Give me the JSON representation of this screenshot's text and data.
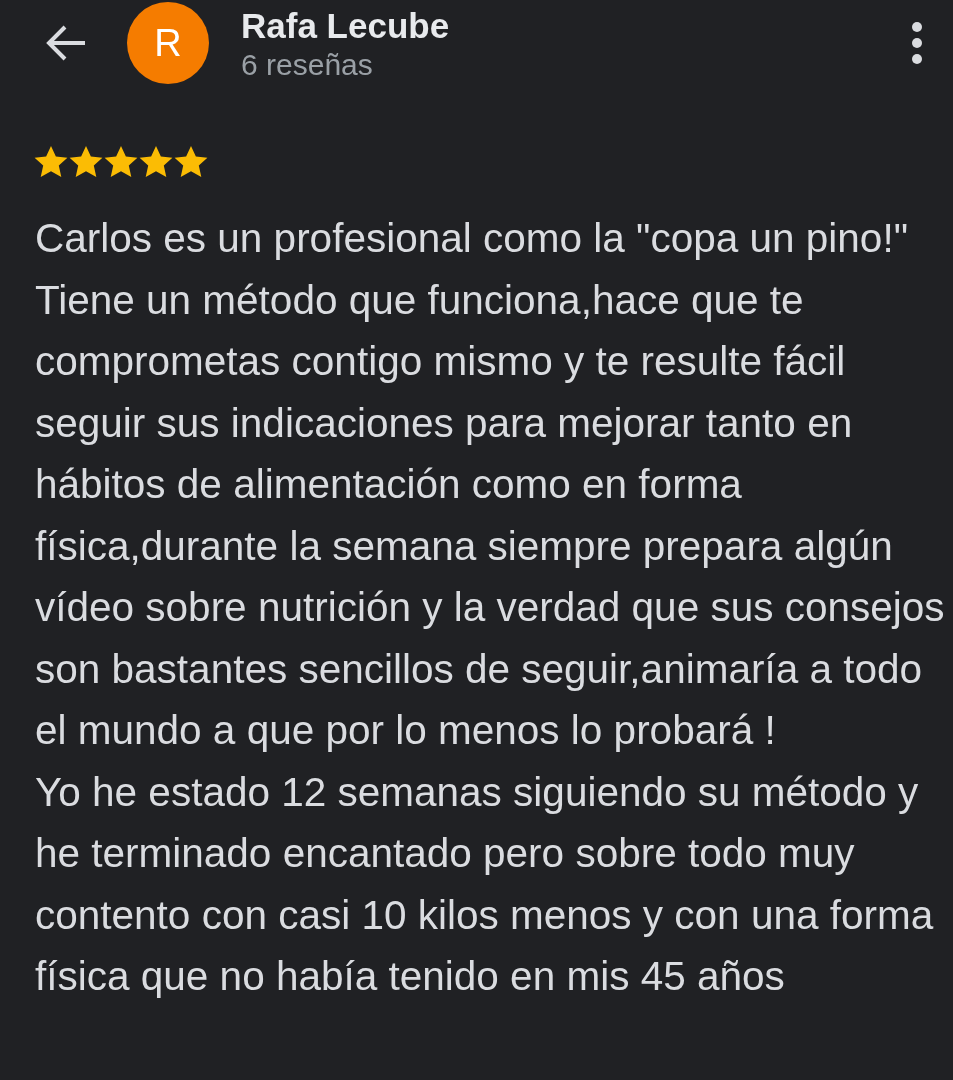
{
  "header": {
    "name": "Rafa Lecube",
    "avatar_letter": "R",
    "review_count": "6 reseñas"
  },
  "review": {
    "stars": 5,
    "paragraphs": [
      "Carlos es un profesional como la \"copa un pino!\" Tiene un método que funciona,hace que te comprometas contigo mismo y te resulte fácil seguir sus indicaciones para mejorar tanto en hábitos de alimentación como en forma física,durante la semana siempre prepara algún vídeo sobre nutrición y la verdad que sus consejos son bastantes sencillos de seguir,animaría a todo el mundo a que por lo menos lo probará !",
      "Yo he estado 12 semanas siguiendo su método y he terminado encantado pero sobre todo muy contento con casi 10 kilos menos y con una forma física que no había tenido en mis 45 años"
    ]
  }
}
